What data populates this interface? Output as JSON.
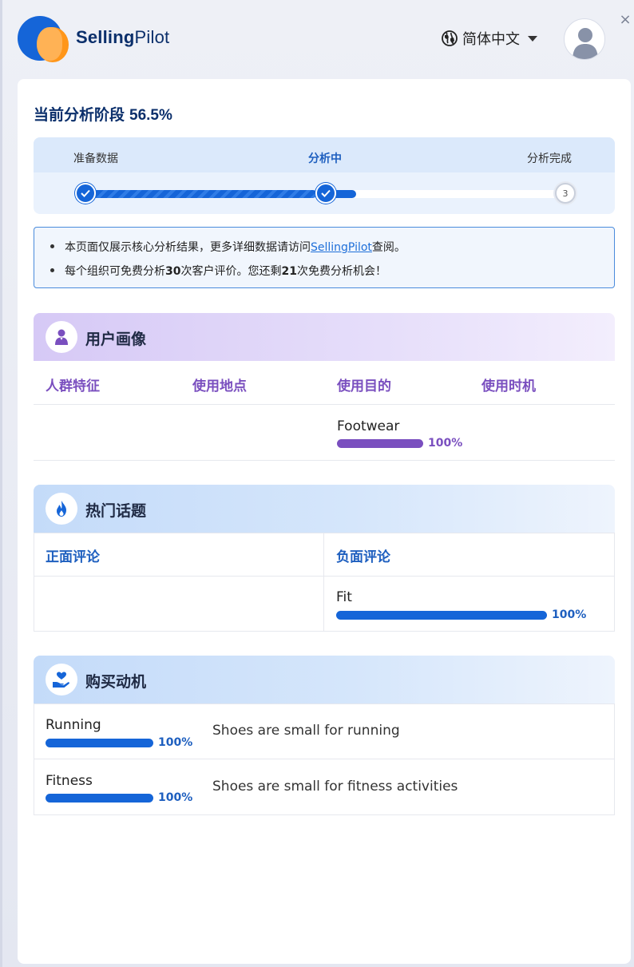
{
  "header": {
    "brand_bold": "Selling",
    "brand_light": "Pilot",
    "language": "简体中文"
  },
  "stage": {
    "title": "当前分析阶段",
    "percent": "56.5%",
    "progress_fraction": 0.565,
    "steps": [
      "准备数据",
      "分析中",
      "分析完成"
    ],
    "step3_number": "3"
  },
  "notice": {
    "line1_prefix": "本页面仅展示核心分析结果，更多详细数据请访问",
    "line1_link": "SellingPilot",
    "line1_suffix": "查阅。",
    "line2_prefix": "每个组织可免费分析",
    "line2_num1": "30",
    "line2_mid": "次客户评价。您还剩",
    "line2_num2": "21",
    "line2_suffix": "次免费分析机会！"
  },
  "persona": {
    "title": "用户画像",
    "columns": [
      "人群特征",
      "使用地点",
      "使用目的",
      "使用时机"
    ],
    "purpose_item": {
      "label": "Footwear",
      "pct": "100%",
      "fraction": 1.0
    }
  },
  "topics": {
    "title": "热门话题",
    "positive_title": "正面评论",
    "negative_title": "负面评论",
    "negative_item": {
      "label": "Fit",
      "pct": "100%",
      "fraction": 1.0
    }
  },
  "motivation": {
    "title": "购买动机",
    "rows": [
      {
        "label": "Running",
        "pct": "100%",
        "fraction": 1.0,
        "text": "Shoes are small for running"
      },
      {
        "label": "Fitness",
        "pct": "100%",
        "fraction": 1.0,
        "text": "Shoes are small for fitness activities"
      }
    ]
  },
  "colors": {
    "primary_blue": "#1565d8",
    "purple": "#7a4fbf",
    "brand_orange": "#ff9619",
    "navy": "#0b2f6b"
  }
}
